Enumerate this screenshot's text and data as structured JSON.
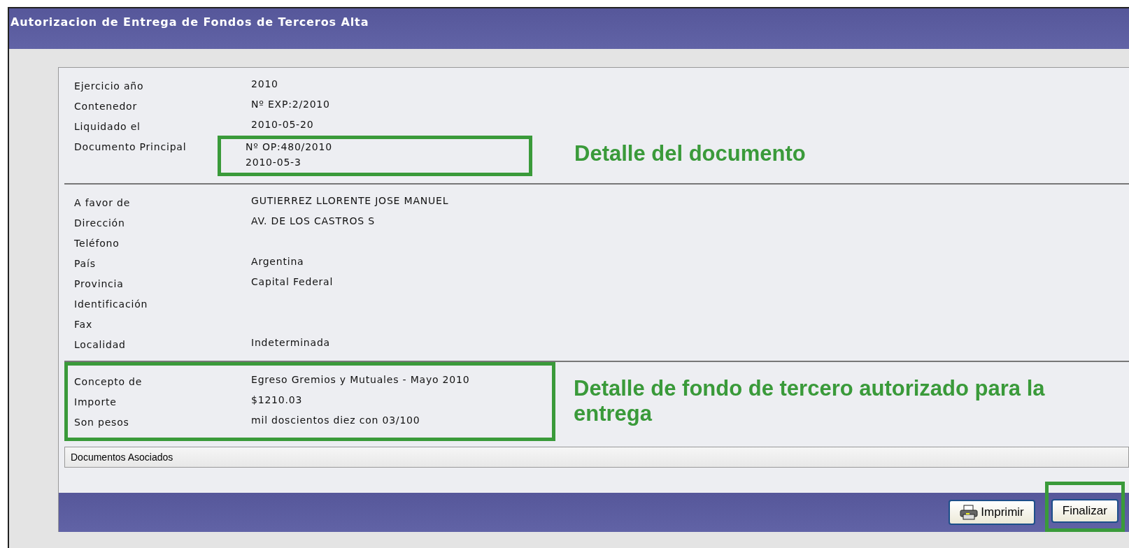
{
  "window": {
    "title": "Autorizacion de Entrega de Fondos de Terceros Alta"
  },
  "sections": [
    {
      "annotated": false,
      "callout": "Detalle del documento",
      "rows": [
        {
          "label": "Ejercicio año",
          "values": [
            "2010"
          ]
        },
        {
          "label": "Contenedor",
          "values": [
            "Nº EXP:2/2010"
          ]
        },
        {
          "label": "Liquidado el",
          "values": [
            "2010-05-20"
          ]
        },
        {
          "label": "Documento Principal",
          "values": [
            "Nº OP:480/2010",
            "2010-05-3"
          ],
          "annotated": true
        }
      ]
    },
    {
      "annotated": false,
      "rows": [
        {
          "label": "A favor de",
          "values": [
            "GUTIERREZ LLORENTE JOSE MANUEL"
          ]
        },
        {
          "label": "Dirección",
          "values": [
            "AV. DE LOS CASTROS S"
          ]
        },
        {
          "label": "Teléfono",
          "values": []
        },
        {
          "label": "País",
          "values": [
            "Argentina"
          ]
        },
        {
          "label": "Provincia",
          "values": [
            "Capital Federal"
          ]
        },
        {
          "label": "Identificación",
          "values": []
        },
        {
          "label": "Fax",
          "values": []
        },
        {
          "label": "Localidad",
          "values": [
            "Indeterminada"
          ]
        }
      ]
    },
    {
      "annotated": true,
      "callout": "Detalle de fondo de tercero autorizado para la entrega",
      "rows": [
        {
          "label": "Concepto de",
          "values": [
            "Egreso Gremios y Mutuales - Mayo 2010"
          ]
        },
        {
          "label": "Importe",
          "values": [
            "$1210.03"
          ]
        },
        {
          "label": "Son pesos",
          "values": [
            "mil doscientos diez con 03/100"
          ]
        }
      ]
    }
  ],
  "associated_bar": "Documentos Asociados",
  "buttons": [
    {
      "label": "Imprimir",
      "kind": "print",
      "annotated": false
    },
    {
      "label": "Finalizar",
      "kind": "plain",
      "annotated": true
    }
  ]
}
